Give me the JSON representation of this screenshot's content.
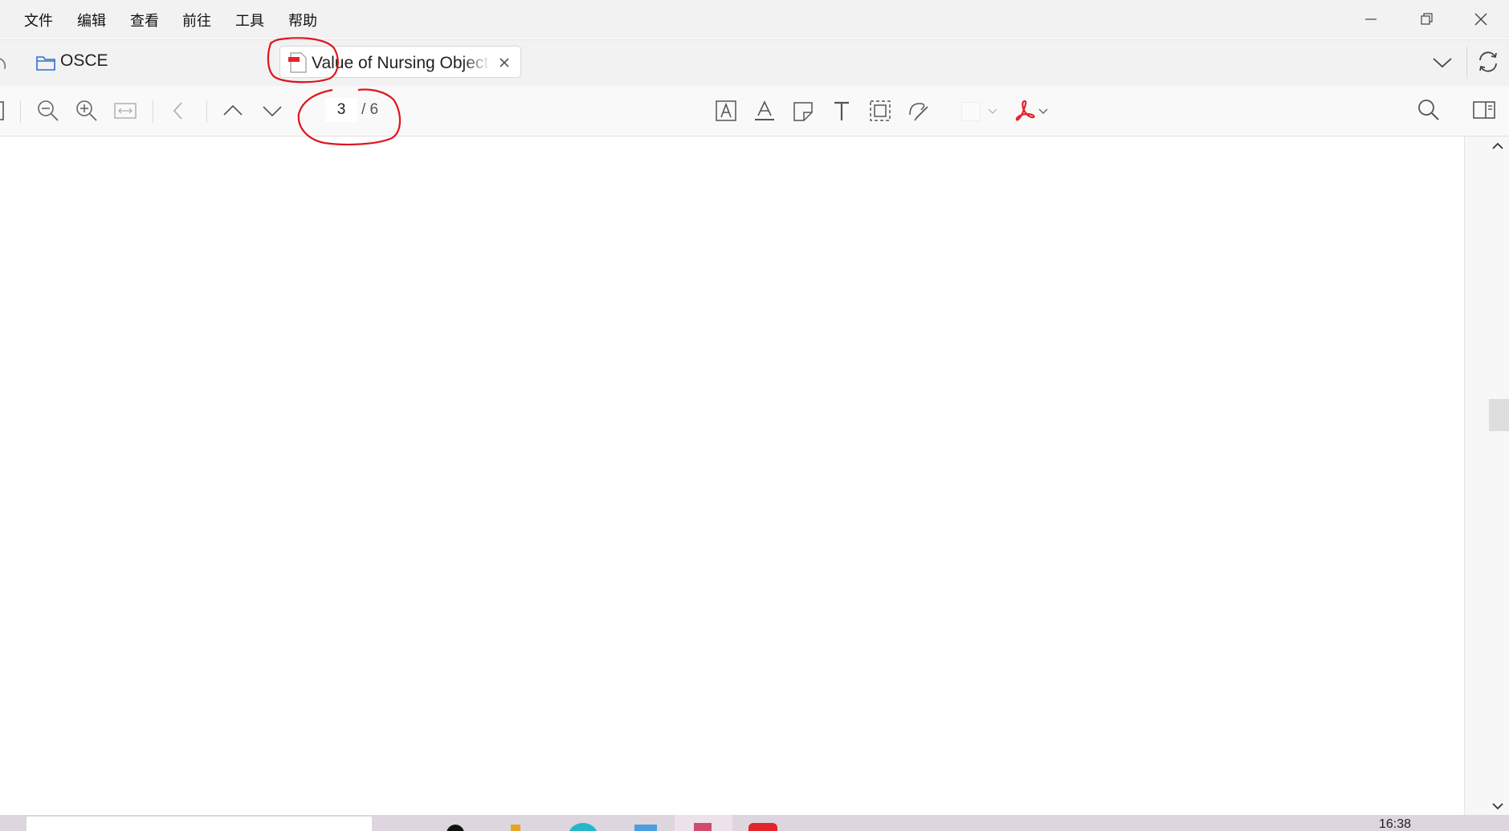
{
  "menu": {
    "items": [
      "文件",
      "编辑",
      "查看",
      "前往",
      "工具",
      "帮助"
    ]
  },
  "tabs": {
    "folder_label": "OSCE",
    "active_tab_title": "Value of Nursing Objective Structured Clinical Examination"
  },
  "toolbar": {
    "current_page": "3",
    "total_pages": "/ 6"
  },
  "colors": {
    "annotation": "#e0141e",
    "acrobat": "#e5232a",
    "folder_icon": "#2b6fd6",
    "chrome_bg": "#f2f2f2",
    "taskbar_bg": "#ddd6de"
  },
  "taskbar": {
    "clock": "16:38"
  }
}
